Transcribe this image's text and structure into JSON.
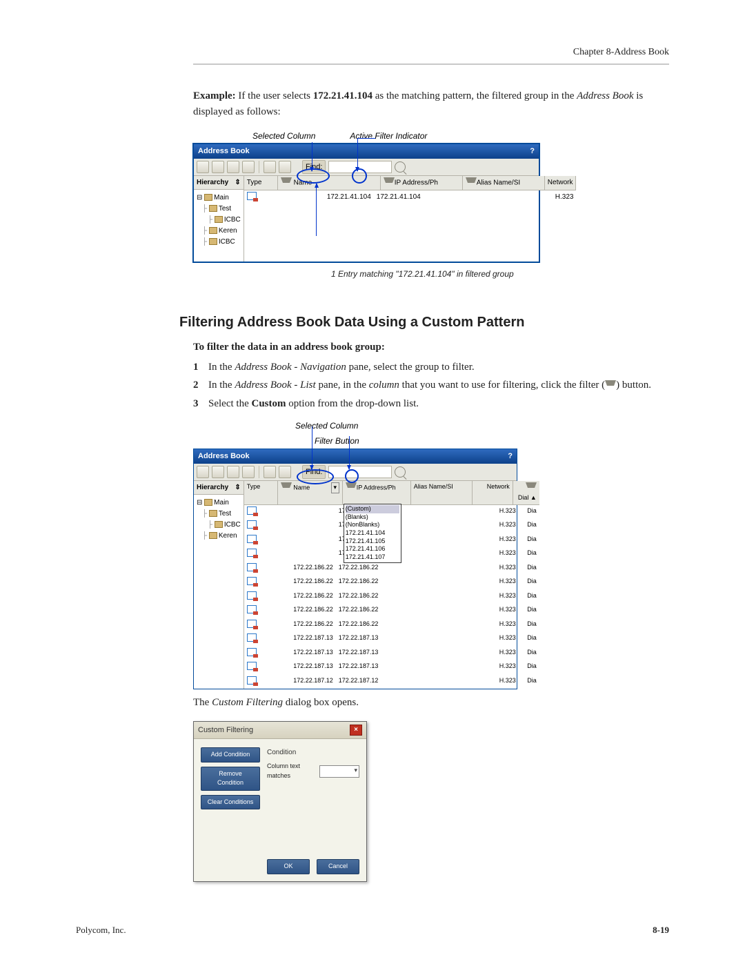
{
  "header": "Chapter 8-Address Book",
  "paragraphs": {
    "example_pre": "Example:",
    "example_text_1": " If the user selects ",
    "example_ip": "172.21.41.104",
    "example_text_2": " as the matching pattern, the filtered group in the ",
    "example_ab": "Address Book",
    "example_text_3": " is displayed as follows:"
  },
  "callouts1": {
    "a": "Selected Column",
    "b": "Active Filter Indicator"
  },
  "screenshot1": {
    "title": "Address Book",
    "find": "Find:",
    "hierarchy": "Hierarchy",
    "type": "Type",
    "name": "Name",
    "ip_col": "IP Address/Ph",
    "alias_col": "Alias Name/SI",
    "network": "Network",
    "sort_icon": "⇕",
    "tree": {
      "root": "Main",
      "c1": "Test",
      "c2": "ICBC",
      "c3": "Keren",
      "c4": "ICBC"
    },
    "row_name": "172.21.41.104",
    "row_ip": "172.21.41.104",
    "row_net": "H.323"
  },
  "caption1": "1 Entry matching \"172.21.41.104\" in filtered group",
  "h2": "Filtering Address Book Data Using a Custom Pattern",
  "proc_intro": "To filter the data in an address book group:",
  "steps": {
    "s1": {
      "n": "1",
      "a": "In the ",
      "b": "Address Book - Navigation",
      "c": " pane, select the group to filter."
    },
    "s2": {
      "n": "2",
      "a": "In the ",
      "b": "Address Book - List",
      "c": " pane, in the ",
      "d": "column",
      "e": " that you want to use for filtering, click the filter (",
      "f": ") button."
    },
    "s3": {
      "n": "3",
      "a": "Select the ",
      "b": "Custom",
      "c": " option from the drop-down list."
    }
  },
  "callouts2": {
    "a": "Selected Column",
    "b": "Filter Button"
  },
  "screenshot2": {
    "dial": "Dial",
    "dropdown": [
      "(Custom)",
      "(Blanks)",
      "(NonBlanks)",
      "172.21.41.104",
      "172.21.41.105",
      "172.21.41.106",
      "172.21.41.107"
    ],
    "rows": [
      {
        "name": "",
        "ip": "172.22.186.23",
        "alias": "",
        "net": "H.323",
        "dial": "Dia"
      },
      {
        "name": "",
        "ip": "172.22.186.23",
        "alias": "",
        "net": "H.323",
        "dial": "Dia"
      },
      {
        "name": "",
        "ip": "172.22.186.23",
        "alias": "",
        "net": "H.323",
        "dial": "Dia"
      },
      {
        "name": "",
        "ip": "172.22.186.23",
        "alias": "",
        "net": "H.323",
        "dial": "Dia"
      },
      {
        "name": "172.22.186.22",
        "ip": "172.22.186.22",
        "alias": "",
        "net": "H.323",
        "dial": "Dia"
      },
      {
        "name": "172.22.186.22",
        "ip": "172.22.186.22",
        "alias": "",
        "net": "H.323",
        "dial": "Dia"
      },
      {
        "name": "172.22.186.22",
        "ip": "172.22.186.22",
        "alias": "",
        "net": "H.323",
        "dial": "Dia"
      },
      {
        "name": "172.22.186.22",
        "ip": "172.22.186.22",
        "alias": "",
        "net": "H.323",
        "dial": "Dia"
      },
      {
        "name": "172.22.186.22",
        "ip": "172.22.186.22",
        "alias": "",
        "net": "H.323",
        "dial": "Dia"
      },
      {
        "name": "172.22.187.13",
        "ip": "172.22.187.13",
        "alias": "",
        "net": "H.323",
        "dial": "Dia"
      },
      {
        "name": "172.22.187.13",
        "ip": "172.22.187.13",
        "alias": "",
        "net": "H.323",
        "dial": "Dia"
      },
      {
        "name": "172.22.187.13",
        "ip": "172.22.187.13",
        "alias": "",
        "net": "H.323",
        "dial": "Dia"
      },
      {
        "name": "172.22.187.12",
        "ip": "172.22.187.12",
        "alias": "",
        "net": "H.323",
        "dial": "Dia"
      }
    ]
  },
  "after_sc2": {
    "pre": "The ",
    "it": "Custom Filtering",
    "post": " dialog box opens."
  },
  "dlg": {
    "title": "Custom Filtering",
    "add": "Add Condition",
    "remove": "Remove Condition",
    "clear": "Clear Conditions",
    "cond": "Condition",
    "match": "Column text matches",
    "ok": "OK",
    "cancel": "Cancel"
  },
  "footer": {
    "company": "Polycom, Inc.",
    "pageno": "8-19"
  }
}
